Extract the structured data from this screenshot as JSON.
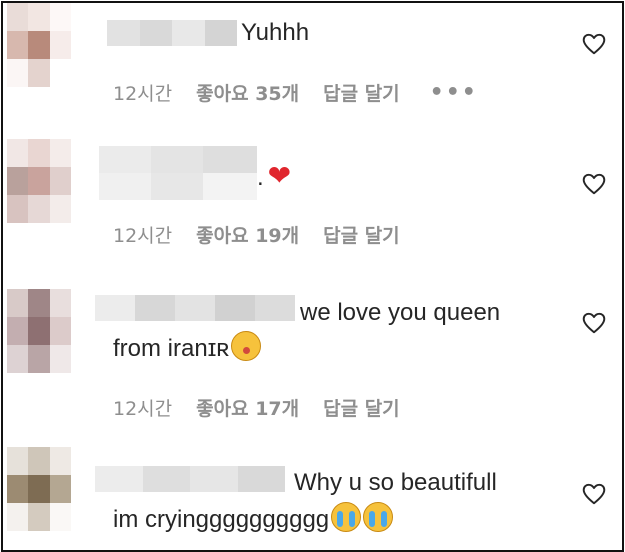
{
  "comments": [
    {
      "text": "Yuhhh",
      "time": "12시간",
      "likes": "좋아요 35개",
      "reply": "답글 달기",
      "more": "•••"
    },
    {
      "text": ".",
      "time": "12시간",
      "likes": "좋아요 19개",
      "reply": "답글 달기"
    },
    {
      "text_line1": "we love you queen",
      "text_line2": "from iranɪʀ",
      "time": "12시간",
      "likes": "좋아요 17개",
      "reply": "답글 달기"
    },
    {
      "text_line1": "Why u so beautifull",
      "text_line2": "im cryingggggggggg"
    }
  ],
  "icons": {
    "like": "heart-outline-icon",
    "red_heart": "red-heart-emoji",
    "kiss": "face-blowing-kiss-emoji",
    "cry": "loudly-crying-face-emoji"
  },
  "colors": {
    "text": "#262626",
    "meta": "#8e8e8e",
    "heart_red": "#e0262e"
  }
}
